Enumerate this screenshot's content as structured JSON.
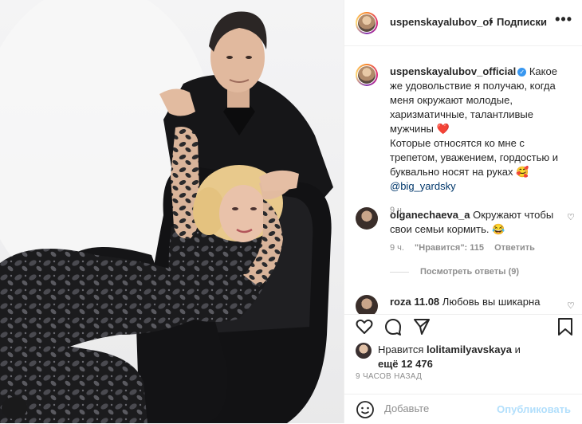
{
  "post": {
    "username": "uspenskayalubov_official",
    "username_short": "uspenskayalubov_of",
    "dot": "•",
    "follow_label": "Подписки",
    "more_label": "•••",
    "caption_lines": [
      "Какое же",
      "удовольствие я получаю, когда меня",
      "окружают молодые, харизматичные,",
      "талантливые мужчины",
      "Которые относятся ко мне с",
      "трепетом, уважением, гордостью и",
      "буквально носят на руках",
      "@big_yardsky"
    ],
    "caption_time": "9 ч.",
    "heart_emoji": "❤️",
    "hug_emoji": "🥰"
  },
  "comments": [
    {
      "user": "olganechaeva_a",
      "text_line1": "Окружают чтобы",
      "text_line2": "свои семьи кормить.",
      "emoji": "😂",
      "time": "9 ч.",
      "likes": "\"Нравится\": 115",
      "reply": "Ответить",
      "view_replies": "Посмотреть ответы (9)"
    },
    {
      "user": "roza 11.08",
      "text": "Любовь вы шикарна"
    }
  ],
  "likes": {
    "prefix": "Нравится",
    "user": "lolitamilyavskaya",
    "suffix": "и",
    "more": "ещё 12 476"
  },
  "posted_ago": "9 ЧАСОВ НАЗАД",
  "comment_box": {
    "placeholder": "Добавьте",
    "publish_label": "Опубликовать"
  },
  "icons": [
    "heart-icon",
    "comment-icon",
    "share-icon",
    "bookmark-icon",
    "more-icon"
  ],
  "colors": {
    "link": "#00376b",
    "publish_disabled": "#b2dffc",
    "meta": "#8e8e8e",
    "verified": "#3897f0"
  }
}
